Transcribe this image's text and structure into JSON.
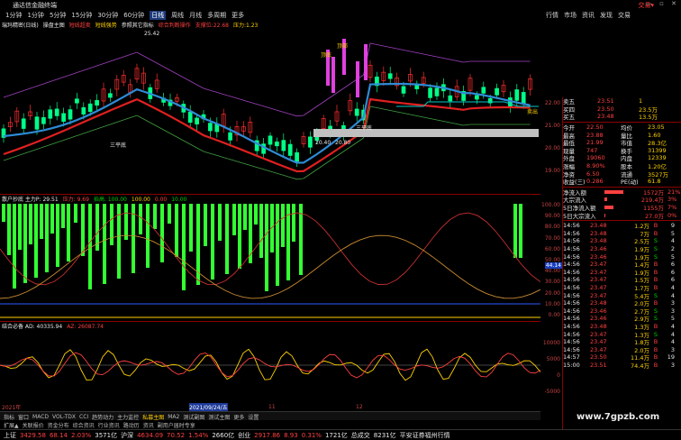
{
  "window": {
    "title": "通达信金融终端",
    "brand": "交易▾",
    "controls": "— ▫ ✕"
  },
  "menu": {
    "items": [
      "1分钟",
      "1分钟",
      "5分钟",
      "15分钟",
      "30分钟",
      "60分钟",
      "日线",
      "周线",
      "月线",
      "多周期",
      "更多"
    ],
    "active": 6
  },
  "menu_right": {
    "items": [
      "行情",
      "市场",
      "资讯",
      "发现",
      "交易"
    ]
  },
  "main": {
    "legend": [
      {
        "text": "瑞玛精密(日线)",
        "color": "#e8e8e8"
      },
      {
        "text": "操盘主图",
        "color": "#e8e8e8"
      },
      {
        "text": "短线超卖",
        "color": "#ff4040"
      },
      {
        "text": "短线强势",
        "color": "#ffd200"
      },
      {
        "text": "参照其它指标",
        "color": "#e8e8e8"
      },
      {
        "text": "综合判断操作",
        "color": "#ff4040"
      },
      {
        "text": "支撑位:22.68",
        "color": "#ff4040"
      },
      {
        "text": "压力:1.23",
        "color": "#ffd200"
      }
    ],
    "labels": [
      "25.42",
      "三平底",
      "三平底",
      "20.40",
      "20.80",
      "顶底",
      "顶部",
      "卖出"
    ],
    "axis": [
      "22.00",
      "21.00",
      "20.00",
      "19.00"
    ]
  },
  "ind1": {
    "legend": [
      {
        "text": "散户抄底 主力P: 29.51",
        "color": "#e8e8e8"
      },
      {
        "text": "压力: 9.69",
        "color": "#ff4040"
      },
      {
        "text": "抬高: 100.00",
        "color": "#00d000"
      },
      {
        "text": "100.00",
        "color": "#ffd200"
      },
      {
        "text": "0.00",
        "color": "#ff4040"
      },
      {
        "text": "10.00",
        "color": "#00d000"
      }
    ],
    "axis": [
      "100.00",
      "90.00",
      "80.00",
      "70.00",
      "60.00",
      "50.00",
      "40.00",
      "30.00",
      "20.00",
      "10.00",
      "0.00"
    ],
    "marker": "44.14"
  },
  "ind2": {
    "legend": [
      {
        "text": "结合必备 AD: 40335.94",
        "color": "#e8e8e8"
      },
      {
        "text": "AZ: 26087.74",
        "color": "#ff4040"
      }
    ],
    "axis": [
      "10000",
      "5000",
      "0",
      "-5000"
    ]
  },
  "datebar": {
    "items": [
      "2021年",
      "2021/09/24/五",
      "11",
      "12"
    ]
  },
  "tabs": {
    "items": [
      "指标",
      "窗口",
      "MACD",
      "VOL-TDX",
      "CCI",
      "趋势动力",
      "主力监控",
      "私募主图",
      "MA2",
      "测试副图",
      "测试主图",
      "更多",
      "设置"
    ],
    "selected": 7
  },
  "tabs2": {
    "items": [
      "扩展▲",
      "关联报价",
      "资金分布",
      "综合资讯",
      "行业资讯",
      "路动历",
      "资讯",
      "副用户届时专享"
    ]
  },
  "panel": {
    "quotes": [
      {
        "label": "卖五",
        "price": "23.51",
        "vol": "1"
      },
      {
        "label": "买四",
        "price": "23.50",
        "vol": "23.5万"
      },
      {
        "label": "买五",
        "price": "23.48",
        "vol": "13.5万"
      }
    ],
    "stats": [
      [
        "今开",
        "22.50",
        "均价",
        "23.05"
      ],
      [
        "最高",
        "23.88",
        "量比",
        "1.60"
      ],
      [
        "最低",
        "21.99",
        "市值",
        "28.3亿"
      ],
      [
        "现量",
        "747",
        "换手",
        "31399"
      ],
      [
        "外盘",
        "19060",
        "内盘",
        "12339"
      ],
      [
        "涨幅",
        "8.90%",
        "股本",
        "1.20亿"
      ],
      [
        "净资",
        "6.50",
        "流通",
        "3527万"
      ],
      [
        "收益(三)",
        "0.286",
        "PE(动)",
        "61.8"
      ]
    ],
    "flows": [
      {
        "label": "净流入额",
        "value": "1572万",
        "pct": "21%",
        "color": "#ff4040",
        "fill": 0.75
      },
      {
        "label": "大宗流入",
        "value": "219.4万",
        "pct": "3%",
        "color": "#ff4040",
        "fill": 0.12
      },
      {
        "label": "5日净流入额",
        "value": "1155万",
        "pct": "7%",
        "color": "#ff4040",
        "fill": 0.35
      },
      {
        "label": "5日大宗流入",
        "value": "27.0万",
        "pct": "0%",
        "color": "#ff4040",
        "fill": 0.05
      }
    ],
    "trades": [
      [
        "14:56",
        "23.48",
        "1.2万",
        "B",
        "9"
      ],
      [
        "14:56",
        "23.48",
        "7万",
        "B",
        "5"
      ],
      [
        "14:56",
        "23.48",
        "2.5万",
        "S",
        "4"
      ],
      [
        "14:56",
        "23.46",
        "1.9万",
        "S",
        "2"
      ],
      [
        "14:56",
        "23.46",
        "1.9万",
        "S",
        "5"
      ],
      [
        "14:56",
        "23.47",
        "1.4万",
        "B",
        "6"
      ],
      [
        "14:56",
        "23.47",
        "1.9万",
        "B",
        "6"
      ],
      [
        "14:56",
        "23.47",
        "1.5万",
        "B",
        "6"
      ],
      [
        "14:56",
        "23.47",
        "1.7万",
        "B",
        "4"
      ],
      [
        "14:56",
        "23.47",
        "5.4万",
        "S",
        "4"
      ],
      [
        "14:56",
        "23.48",
        "2.0万",
        "B",
        "3"
      ],
      [
        "14:56",
        "23.46",
        "2.7万",
        "S",
        "3"
      ],
      [
        "14:56",
        "23.46",
        "2.9万",
        "S",
        "5"
      ],
      [
        "14:56",
        "23.48",
        "1.3万",
        "B",
        "4"
      ],
      [
        "14:56",
        "23.47",
        "1.3万",
        "S",
        "4"
      ],
      [
        "14:56",
        "23.47",
        "1.8万",
        "B",
        "4"
      ],
      [
        "14:56",
        "23.47",
        "2.0万",
        "B",
        "3"
      ],
      [
        "14:57",
        "23.50",
        "11.4万",
        "B",
        "19"
      ],
      [
        "15:00",
        "23.51",
        "74.4万",
        "B",
        "3"
      ]
    ]
  },
  "status": {
    "items": [
      {
        "text": "上证",
        "color": "#e8e8e8"
      },
      {
        "text": "3429.58",
        "color": "#ff4040"
      },
      {
        "text": "68.14",
        "color": "#ff4040"
      },
      {
        "text": "2.03%",
        "color": "#ff4040"
      },
      {
        "text": "3571亿",
        "color": "#e8e8e8"
      },
      {
        "text": "沪深",
        "color": "#e8e8e8"
      },
      {
        "text": "4634.09",
        "color": "#ff4040"
      },
      {
        "text": "70.52",
        "color": "#ff4040"
      },
      {
        "text": "1.54%",
        "color": "#ff4040"
      },
      {
        "text": "2660亿",
        "color": "#e8e8e8"
      },
      {
        "text": "创业",
        "color": "#e8e8e8"
      },
      {
        "text": "2917.86",
        "color": "#ff4040"
      },
      {
        "text": "8.93",
        "color": "#ff4040"
      },
      {
        "text": "0.31%",
        "color": "#ff4040"
      },
      {
        "text": "1721亿",
        "color": "#e8e8e8"
      },
      {
        "text": "总成交",
        "color": "#e8e8e8"
      },
      {
        "text": "8231亿",
        "color": "#e8e8e8"
      },
      {
        "text": "平安证券福州行情",
        "color": "#e8e8e8"
      }
    ]
  },
  "watermark": "www.7gpzb.com"
}
